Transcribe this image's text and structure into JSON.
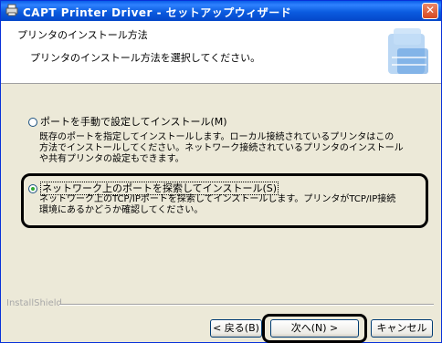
{
  "window": {
    "title": "CAPT Printer Driver - セットアップウィザード",
    "close_glyph": "✕"
  },
  "header": {
    "title": "プリンタのインストール方法",
    "subtitle": "プリンタのインストール方法を選択してください。"
  },
  "options": [
    {
      "label": "ポートを手動で設定してインストール(M)",
      "selected": false,
      "description_lines": [
        "既存のポートを指定してインストールします。ローカル接続されているプリンタはこの",
        "方法でインストールしてください。ネットワーク接続されているプリンタのインストール",
        "や共有プリンタの設定もできます。"
      ]
    },
    {
      "label": "ネットワーク上のポートを探索してインストール(S)",
      "selected": true,
      "description_lines": [
        "ネットワーク上のTCP/IPポートを探索してインストールします。プリンタがTCP/IP接続",
        "環境にあるかどうか確認してください。"
      ]
    }
  ],
  "footer": {
    "installshield": "InstallShield",
    "back_label": "< 戻る(B)",
    "next_label": "次へ(N) >",
    "cancel_label": "キャンセル"
  },
  "colors": {
    "title_bar": "#0a5ee8",
    "dialog_bg": "#ece9d8",
    "radio_dot": "#2fa82f"
  }
}
